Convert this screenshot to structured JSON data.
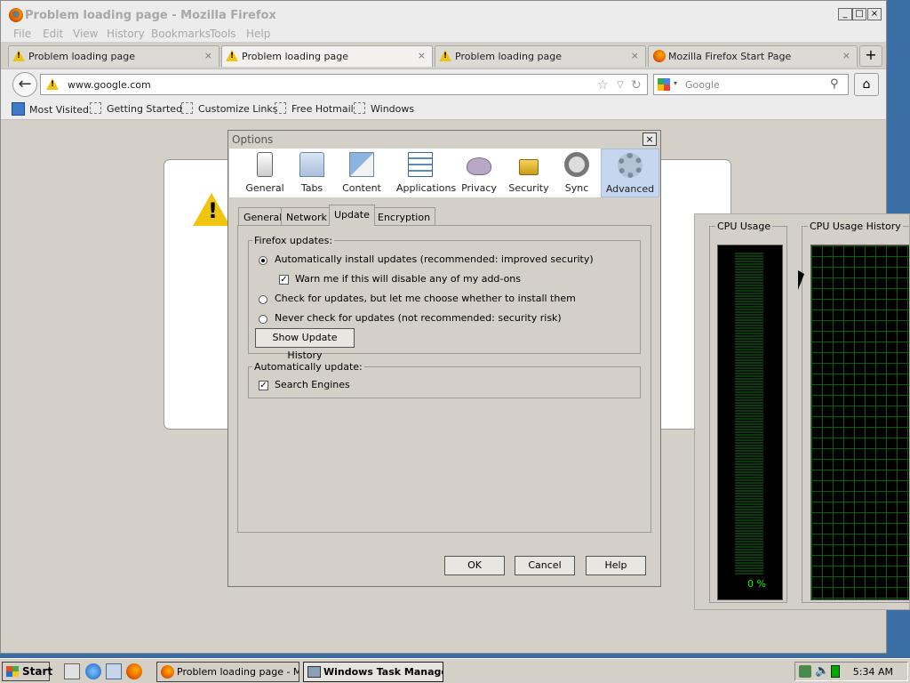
{
  "firefox": {
    "title": "Problem loading page - Mozilla Firefox",
    "menu": [
      "File",
      "Edit",
      "View",
      "History",
      "Bookmarks",
      "Tools",
      "Help"
    ],
    "tabs": [
      {
        "label": "Problem loading page",
        "icon": "warning-icon",
        "active": false
      },
      {
        "label": "Problem loading page",
        "icon": "warning-icon",
        "active": true
      },
      {
        "label": "Problem loading page",
        "icon": "warning-icon",
        "active": false
      },
      {
        "label": "Mozilla Firefox Start Page",
        "icon": "firefox-icon",
        "active": false
      }
    ],
    "close_glyph": "×",
    "new_tab_glyph": "+",
    "url": "www.google.com",
    "search_placeholder": "Google",
    "bookmarks": [
      "Most Visited",
      "Getting Started",
      "Customize Links",
      "Free Hotmail",
      "Windows"
    ]
  },
  "options": {
    "title": "Options",
    "panes": [
      "General",
      "Tabs",
      "Content",
      "Applications",
      "Privacy",
      "Security",
      "Sync",
      "Advanced"
    ],
    "selected_pane": "Advanced",
    "subtabs": [
      "General",
      "Network",
      "Update",
      "Encryption"
    ],
    "selected_subtab": "Update",
    "firefox_updates_label": "Firefox updates:",
    "radio_auto": "Automatically install updates (recommended: improved security)",
    "check_warn": "Warn me if this will disable any of my add-ons",
    "radio_check": "Check for updates, but let me choose whether to install them",
    "radio_never": "Never check for updates (not recommended: security risk)",
    "show_history": "Show Update History",
    "auto_update_label": "Automatically update:",
    "check_search": "Search Engines",
    "ok": "OK",
    "cancel": "Cancel",
    "help": "Help"
  },
  "taskmanager": {
    "cpu_usage_label": "CPU Usage",
    "cpu_history_label": "CPU Usage History",
    "cpu_percent": "0 %"
  },
  "taskbar": {
    "start": "Start",
    "buttons": [
      "Problem loading page - M...",
      "Windows Task Manager"
    ],
    "clock": "5:34 AM"
  },
  "colors": {
    "desktop": "#3a6ea5",
    "chrome": "#d4d0c8",
    "meter_green": "#00ff00",
    "grid_green": "#006400",
    "warning_yellow": "#f1c40f"
  }
}
